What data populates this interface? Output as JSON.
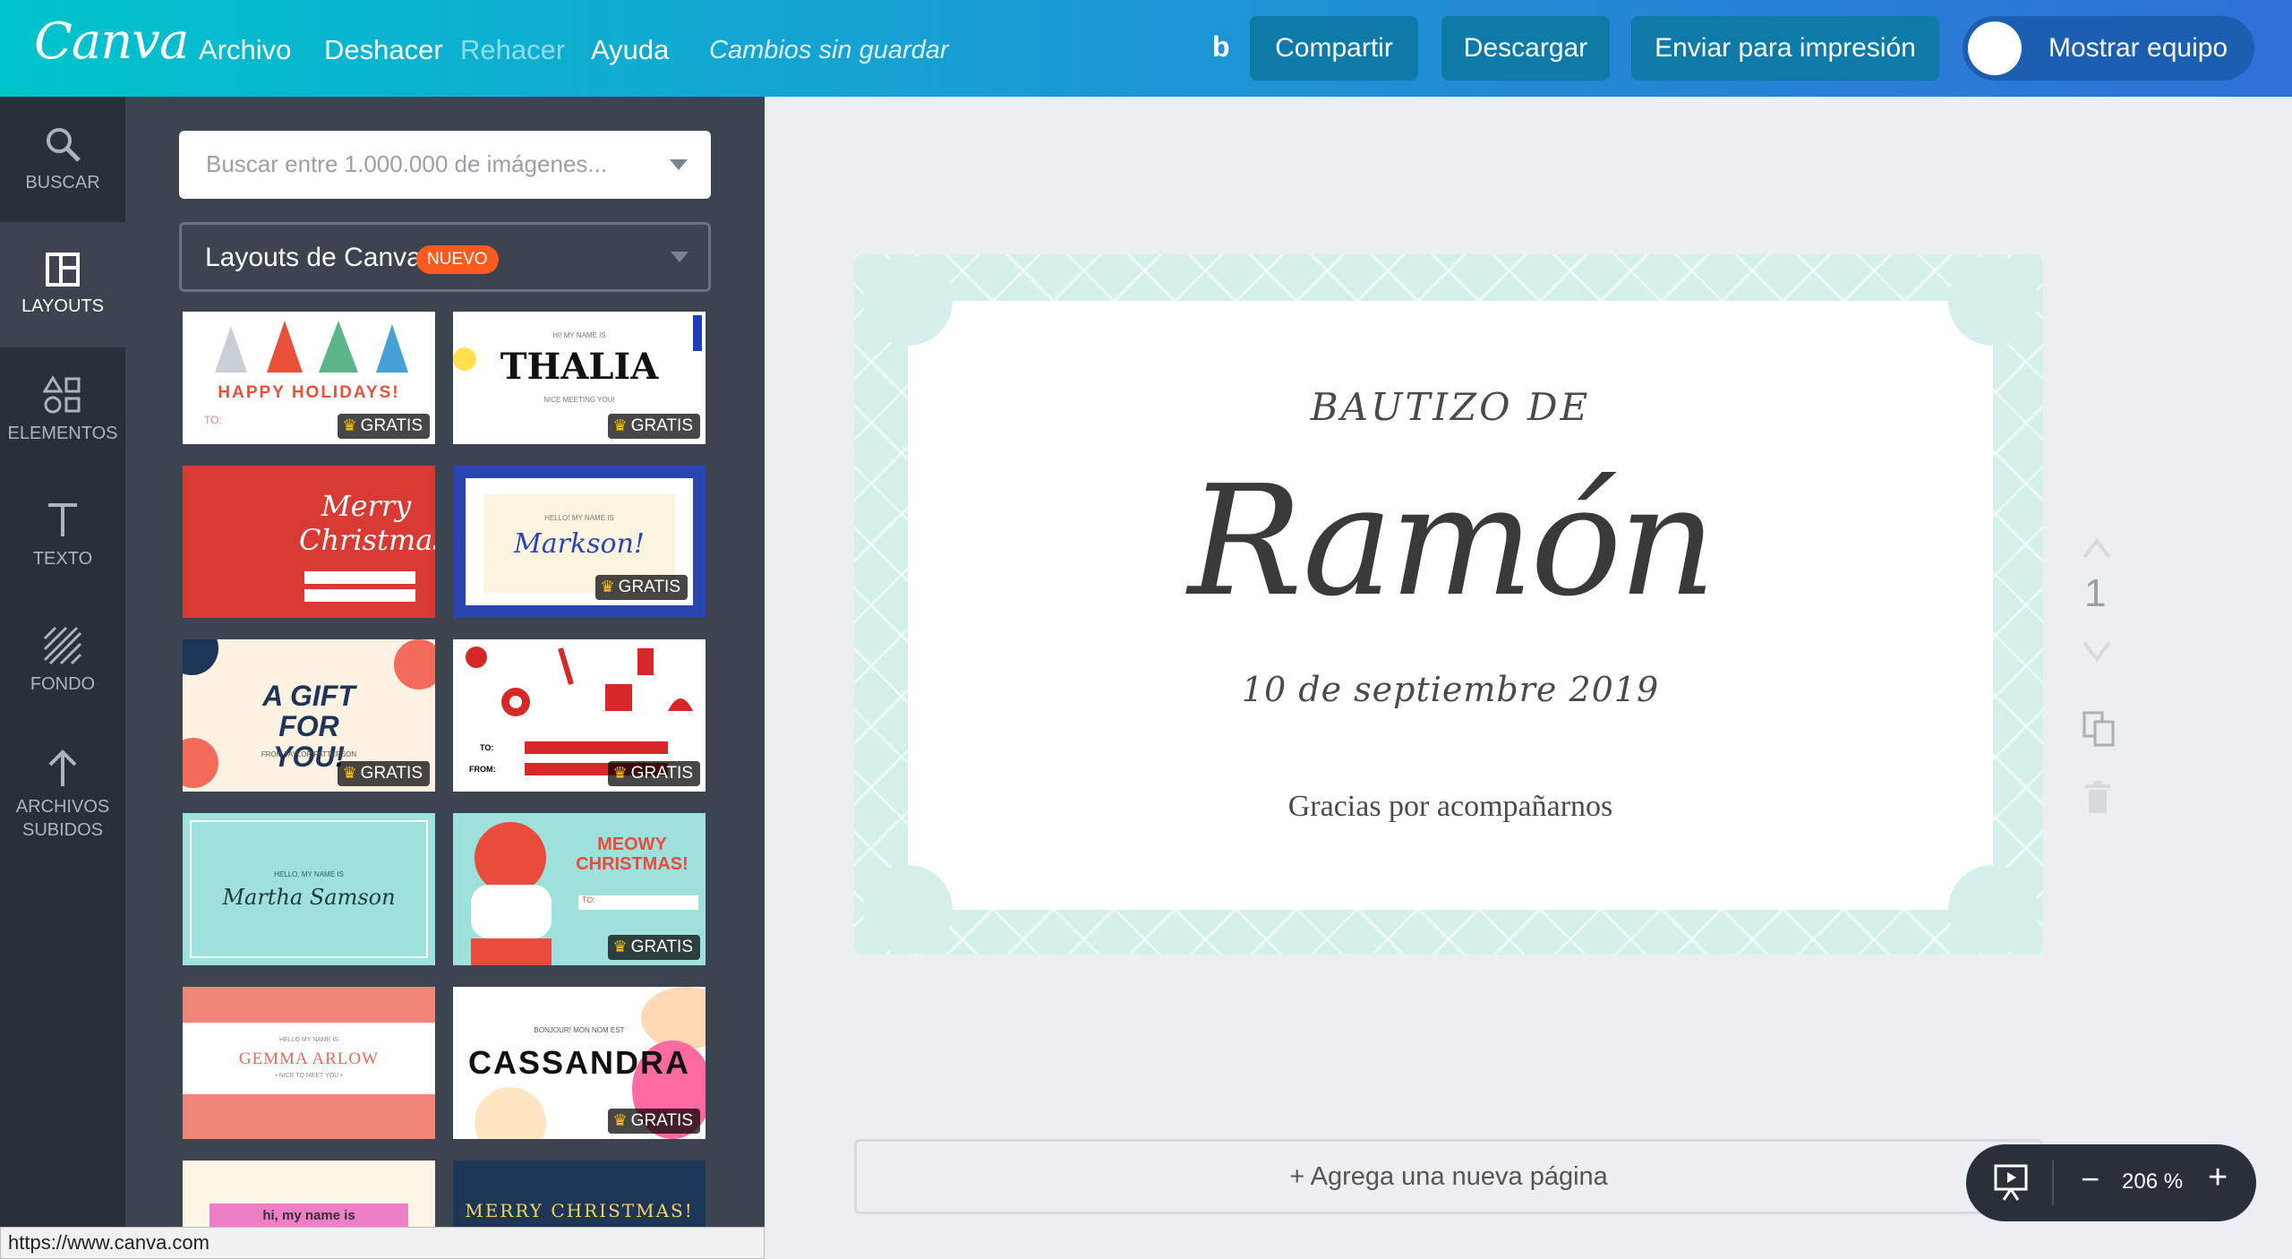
{
  "app": {
    "logo": "Canva"
  },
  "menu": {
    "file": "Archivo",
    "undo": "Deshacer",
    "redo": "Rehacer",
    "help": "Ayuda",
    "status": "Cambios sin guardar"
  },
  "toolbar": {
    "b_icon": "b",
    "share": "Compartir",
    "download": "Descargar",
    "print": "Enviar para impresión",
    "team": "Mostrar equipo"
  },
  "rail": {
    "items": [
      {
        "icon": "search-icon",
        "label": "BUSCAR"
      },
      {
        "icon": "layouts-icon",
        "label": "LAYOUTS"
      },
      {
        "icon": "elements-icon",
        "label": "ELEMENTOS"
      },
      {
        "icon": "text-icon",
        "label": "TEXTO"
      },
      {
        "icon": "background-icon",
        "label": "FONDO"
      },
      {
        "icon": "upload-icon",
        "label_1": "ARCHIVOS",
        "label_2": "SUBIDOS"
      }
    ]
  },
  "panel": {
    "search_placeholder": "Buscar entre 1.000.000 de imágenes...",
    "layouts_label": "Layouts de Canva",
    "new_badge": "NUEVO",
    "free_label": "GRATIS",
    "thumbs": [
      {
        "text": "HAPPY HOLIDAYS!",
        "sub": "TO:"
      },
      {
        "text": "THALIA",
        "sub_top": "HI! MY NAME IS",
        "sub": "NICE MEETING YOU!"
      },
      {
        "text": "Merry Christmas!"
      },
      {
        "text": "Markson!",
        "sub_top": "HELLO! MY NAME IS"
      },
      {
        "text": "A GIFT FOR YOU!",
        "sub": "FROM TAYLOR PATTERSON"
      },
      {
        "text": "TO:",
        "sub": "FROM:"
      },
      {
        "text": "Martha Samson",
        "sub_top": "HELLO, MY NAME IS"
      },
      {
        "text": "MEOWY CHRISTMAS!",
        "sub": "TO:"
      },
      {
        "text": "GEMMA ARLOW",
        "sub_top": "HELLO MY NAME IS",
        "sub": "• NICE TO MEET YOU •"
      },
      {
        "text": "CASSANDRA",
        "sub_top": "BONJOUR! MON NOM EST"
      },
      {
        "text": "hi, my name is"
      },
      {
        "text": "MERRY CHRISTMAS!"
      }
    ]
  },
  "card": {
    "eyebrow": "BAUTIZO DE",
    "name": "Ramón",
    "date": "10 de septiembre 2019",
    "thanks": "Gracias por acompañarnos"
  },
  "page_number": "1",
  "add_page": "+ Agrega una nueva página",
  "zoom": {
    "value": "206 %",
    "minus": "−",
    "plus": "+"
  },
  "status_url": "https://www.canva.com"
}
